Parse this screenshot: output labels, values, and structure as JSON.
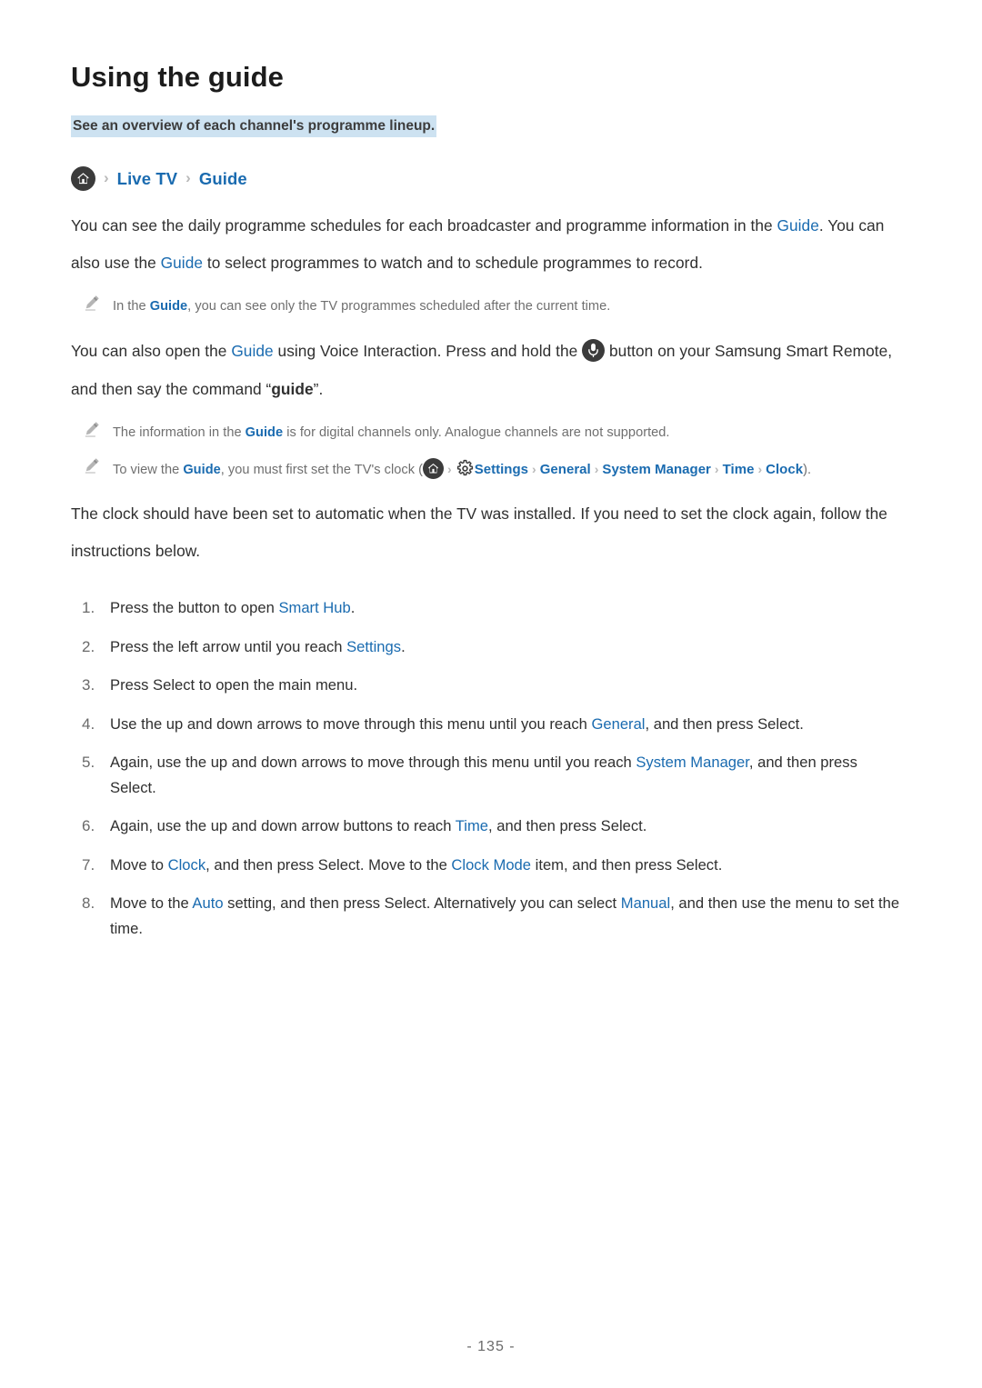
{
  "page": {
    "title": "Using the guide",
    "subtitle": "See an overview of each channel's programme lineup.",
    "footer": "- 135 -"
  },
  "breadcrumb": {
    "home_icon": "home-icon",
    "separator": "›",
    "items": [
      {
        "label": "Live TV"
      },
      {
        "label": "Guide"
      }
    ]
  },
  "paragraphs": {
    "intro": {
      "part1": "You can see the daily programme schedules for each broadcaster and programme information in the ",
      "link1": "Guide",
      "part2": ". You can also use the ",
      "link2": "Guide",
      "part3": " to select programmes to watch and to schedule programmes to record."
    },
    "voice": {
      "part1": "You can also open the ",
      "link1": "Guide",
      "part2": " using Voice Interaction. Press and hold the ",
      "mic_icon": "microphone-icon",
      "part3": " button on your Samsung Smart Remote, and then say the command “",
      "bold1": "guide",
      "part4": "”."
    },
    "clock_intro": "The clock should have been set to automatic when the TV was installed. If you need to set the clock again, follow the instructions below."
  },
  "notes": [
    {
      "icon": "pencil-icon",
      "part1": "In the ",
      "link1": "Guide",
      "part2": ", you can see only the TV programmes scheduled after the current time."
    },
    {
      "icon": "pencil-icon",
      "part1": "The information in the ",
      "link1": "Guide",
      "part2": " is for digital channels only. Analogue channels are not supported."
    }
  ],
  "clock_path_note": {
    "icon": "pencil-icon",
    "part1": "To view the ",
    "link1": "Guide",
    "part2": ", you must first set the TV's clock (",
    "home_icon": "home-icon",
    "gear_icon": "gear-icon",
    "separator": "›",
    "path": [
      "Settings",
      "General",
      "System Manager",
      "Time",
      "Clock"
    ],
    "part3": ")."
  },
  "steps": [
    {
      "num": "1.",
      "part1": "Press the button to open ",
      "link1": "Smart Hub",
      "part2": "."
    },
    {
      "num": "2.",
      "part1": "Press the left arrow until you reach ",
      "link1": "Settings",
      "part2": "."
    },
    {
      "num": "3.",
      "part1": "Press Select to open the main menu.",
      "link1": "",
      "part2": ""
    },
    {
      "num": "4.",
      "part1": "Use the up and down arrows to move through this menu until you reach ",
      "link1": "General",
      "part2": ", and then press Select."
    },
    {
      "num": "5.",
      "part1": "Again, use the up and down arrows to move through this menu until you reach ",
      "link1": "System Manager",
      "part2": ", and then press Select."
    },
    {
      "num": "6.",
      "part1": "Again, use the up and down arrow buttons to reach ",
      "link1": "Time",
      "part2": ", and then press Select."
    },
    {
      "num": "7.",
      "part1": "Move to ",
      "link1": "Clock",
      "part2": ", and then press Select. Move to the ",
      "link2": "Clock Mode",
      "part3": " item, and then press Select."
    },
    {
      "num": "8.",
      "part1": "Move to the ",
      "link1": "Auto",
      "part2": " setting, and then press Select. Alternatively you can select ",
      "link2": "Manual",
      "part3": ", and then use the menu to set the time."
    }
  ],
  "colors": {
    "link": "#1a6bb0",
    "highlight": "#cde2f1",
    "body_text": "#2f2f2f",
    "note_text": "#6f6f6f",
    "icon_dark": "#3b3b3b"
  }
}
